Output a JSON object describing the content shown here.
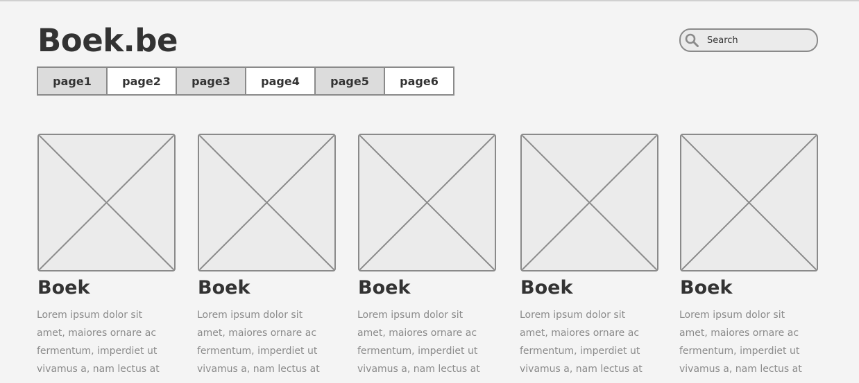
{
  "header": {
    "logo": "Boek.be",
    "search": {
      "placeholder": "Search",
      "icon": "search-icon"
    }
  },
  "nav": {
    "items": [
      {
        "label": "page1",
        "shaded": true
      },
      {
        "label": "page2",
        "shaded": false
      },
      {
        "label": "page3",
        "shaded": true
      },
      {
        "label": "page4",
        "shaded": false
      },
      {
        "label": "page5",
        "shaded": true
      },
      {
        "label": "page6",
        "shaded": false
      }
    ]
  },
  "books": [
    {
      "title": "Boek",
      "description": "Lorem ipsum dolor sit amet, maiores ornare ac fermentum, imperdiet ut vivamus a, nam lectus at"
    },
    {
      "title": "Boek",
      "description": "Lorem ipsum dolor sit amet, maiores ornare ac fermentum, imperdiet ut vivamus a, nam lectus at"
    },
    {
      "title": "Boek",
      "description": "Lorem ipsum dolor sit amet, maiores ornare ac fermentum, imperdiet ut vivamus a, nam lectus at"
    },
    {
      "title": "Boek",
      "description": "Lorem ipsum dolor sit amet, maiores ornare ac fermentum, imperdiet ut vivamus a, nam lectus at"
    },
    {
      "title": "Boek",
      "description": "Lorem ipsum dolor sit amet, maiores ornare ac fermentum, imperdiet ut vivamus a, nam lectus at"
    }
  ],
  "colors": {
    "background": "#f4f4f4",
    "text": "#333333",
    "muted_text": "#8a8a8a",
    "border": "#8a8a8a",
    "placeholder_fill": "#ebebeb",
    "nav_shaded": "#dcdcdc"
  }
}
